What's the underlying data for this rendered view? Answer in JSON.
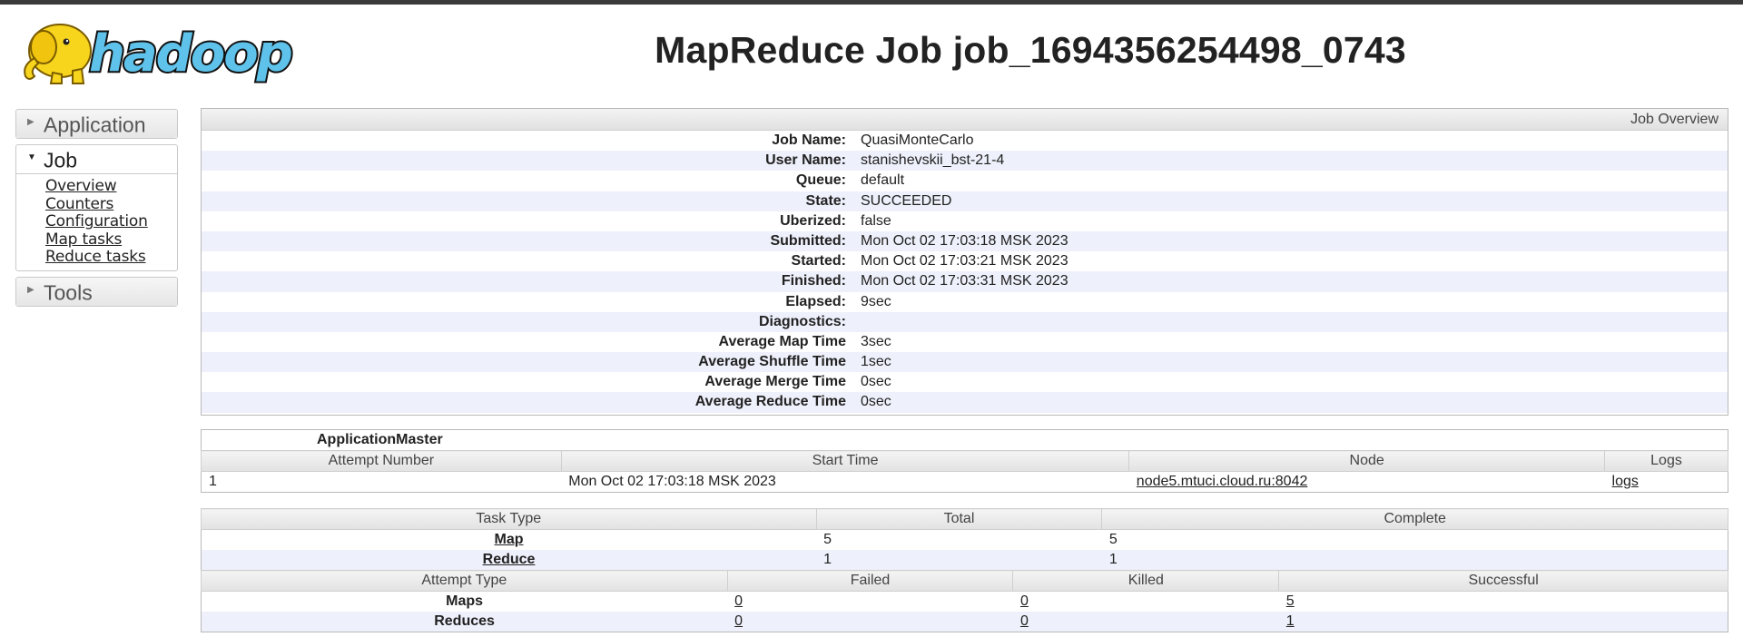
{
  "header": {
    "logo_text": "hadoop",
    "title": "MapReduce Job job_1694356254498_0743"
  },
  "nav": {
    "sections": [
      {
        "label": "Application",
        "open": false
      },
      {
        "label": "Job",
        "open": true,
        "links": [
          "Overview",
          "Counters",
          "Configuration",
          "Map tasks",
          "Reduce tasks"
        ]
      },
      {
        "label": "Tools",
        "open": false
      }
    ]
  },
  "overview": {
    "header": "Job Overview",
    "rows": [
      {
        "key": "Job Name:",
        "value": "QuasiMonteCarlo"
      },
      {
        "key": "User Name:",
        "value": "stanishevskii_bst-21-4"
      },
      {
        "key": "Queue:",
        "value": "default"
      },
      {
        "key": "State:",
        "value": "SUCCEEDED"
      },
      {
        "key": "Uberized:",
        "value": "false"
      },
      {
        "key": "Submitted:",
        "value": "Mon Oct 02 17:03:18 MSK 2023"
      },
      {
        "key": "Started:",
        "value": "Mon Oct 02 17:03:21 MSK 2023"
      },
      {
        "key": "Finished:",
        "value": "Mon Oct 02 17:03:31 MSK 2023"
      },
      {
        "key": "Elapsed:",
        "value": "9sec"
      },
      {
        "key": "Diagnostics:",
        "value": ""
      },
      {
        "key": "Average Map Time",
        "value": "3sec"
      },
      {
        "key": "Average Shuffle Time",
        "value": "1sec"
      },
      {
        "key": "Average Merge Time",
        "value": "0sec"
      },
      {
        "key": "Average Reduce Time",
        "value": "0sec"
      }
    ]
  },
  "am": {
    "caption": "ApplicationMaster",
    "headers": [
      "Attempt Number",
      "Start Time",
      "Node",
      "Logs"
    ],
    "row": {
      "attempt": "1",
      "start": "Mon Oct 02 17:03:18 MSK 2023",
      "node": "node5.mtuci.cloud.ru:8042",
      "logs": "logs"
    }
  },
  "tasks": {
    "headers": [
      "Task Type",
      "Total",
      "Complete"
    ],
    "rows": [
      {
        "type": "Map",
        "total": "5",
        "complete": "5"
      },
      {
        "type": "Reduce",
        "total": "1",
        "complete": "1"
      }
    ]
  },
  "attempts": {
    "headers": [
      "Attempt Type",
      "Failed",
      "Killed",
      "Successful"
    ],
    "rows": [
      {
        "type": "Maps",
        "failed": "0",
        "killed": "0",
        "successful": "5"
      },
      {
        "type": "Reduces",
        "failed": "0",
        "killed": "0",
        "successful": "1"
      }
    ]
  }
}
